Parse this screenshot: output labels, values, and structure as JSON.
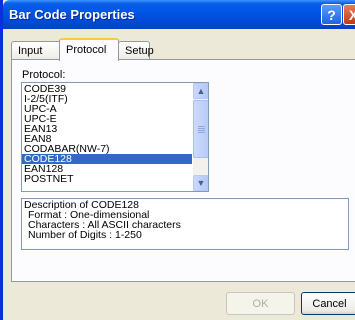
{
  "window": {
    "title": "Bar Code Properties",
    "help_glyph": "?",
    "close_glyph": "X"
  },
  "tabs": [
    {
      "label": "Input",
      "active": false
    },
    {
      "label": "Protocol",
      "active": true
    },
    {
      "label": "Setup",
      "active": false
    }
  ],
  "protocol": {
    "label": "Protocol:",
    "items": [
      "CODE39",
      "I-2/5(ITF)",
      "UPC-A",
      "UPC-E",
      "EAN13",
      "EAN8",
      "CODABAR(NW-7)",
      "CODE128",
      "EAN128",
      "POSTNET"
    ],
    "selected": "CODE128"
  },
  "description": {
    "title": "Description of CODE128",
    "format": "Format : One-dimensional",
    "characters": "Characters : All ASCII characters",
    "digits": "Number of Digits : 1-250"
  },
  "buttons": {
    "ok_label": "OK",
    "ok_enabled": false,
    "cancel_label": "Cancel"
  },
  "colors": {
    "title_bar": "#0055e5",
    "selection": "#316ac5",
    "dialog_bg": "#ece9d8"
  }
}
